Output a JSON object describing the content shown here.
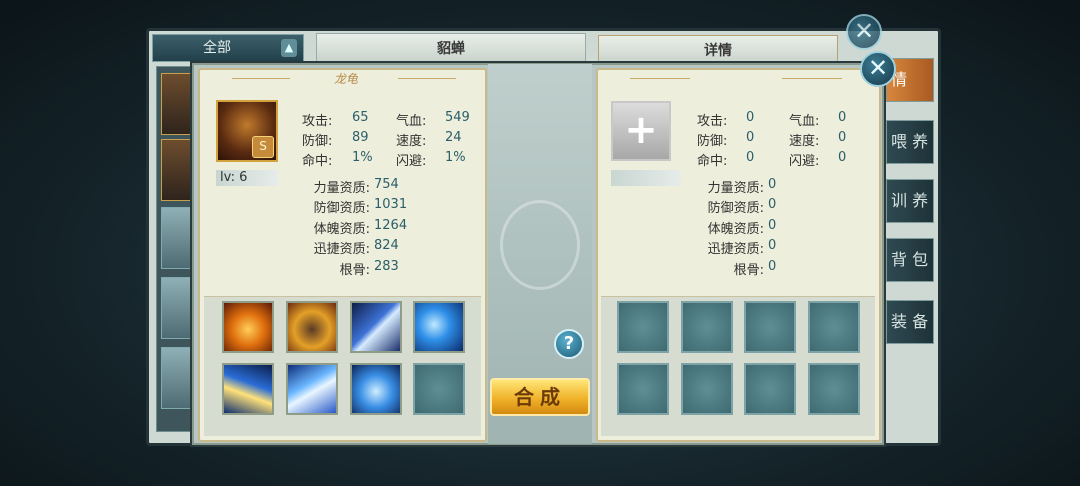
{
  "background": {
    "filter_label": "全部",
    "panel_title": "貂蝉",
    "detail_tab": "详情",
    "side_tabs": [
      "情",
      "喂 养",
      "训 养",
      "背 包",
      "装 备"
    ]
  },
  "left_pet": {
    "name": "龙龟",
    "grade": "S",
    "level": "lv: 6",
    "stats": [
      {
        "label": "攻击:",
        "value": "65"
      },
      {
        "label": "气血:",
        "value": "549"
      },
      {
        "label": "防御:",
        "value": "89"
      },
      {
        "label": "速度:",
        "value": "24"
      },
      {
        "label": "命中:",
        "value": "1%"
      },
      {
        "label": "闪避:",
        "value": "1%"
      }
    ],
    "aptitudes": [
      {
        "label": "力量资质:",
        "value": "754"
      },
      {
        "label": "防御资质:",
        "value": "1031"
      },
      {
        "label": "体魄资质:",
        "value": "1264"
      },
      {
        "label": "迅捷资质:",
        "value": "824"
      },
      {
        "label": "根骨:",
        "value": "283"
      }
    ],
    "skills": [
      "shield-fire-skill-icon",
      "beast-roar-skill-icon",
      "claw-slash-skill-icon",
      "ice-beast-skill-icon",
      "lightning-strike-skill-icon",
      "blade-dash-skill-icon",
      "water-heart-skill-icon",
      "empty-skill-slot"
    ]
  },
  "right_pet": {
    "stats": [
      {
        "label": "攻击:",
        "value": "0"
      },
      {
        "label": "气血:",
        "value": "0"
      },
      {
        "label": "防御:",
        "value": "0"
      },
      {
        "label": "速度:",
        "value": "0"
      },
      {
        "label": "命中:",
        "value": "0"
      },
      {
        "label": "闪避:",
        "value": "0"
      }
    ],
    "aptitudes": [
      {
        "label": "力量资质:",
        "value": "0"
      },
      {
        "label": "防御资质:",
        "value": "0"
      },
      {
        "label": "体魄资质:",
        "value": "0"
      },
      {
        "label": "迅捷资质:",
        "value": "0"
      },
      {
        "label": "根骨:",
        "value": "0"
      }
    ]
  },
  "actions": {
    "help": "?",
    "synthesize": "合成",
    "close": "✕",
    "add": "+"
  },
  "colors": {
    "accent_gold": "#f0b22a",
    "value_teal": "#2a5e6a",
    "card_bg": "#eeeedc"
  }
}
